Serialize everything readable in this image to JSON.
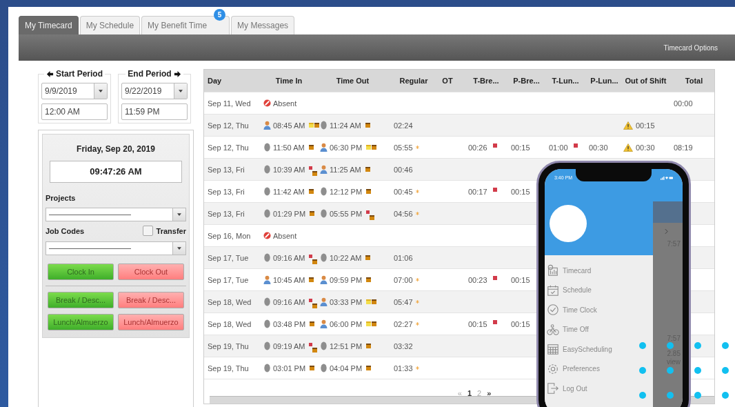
{
  "tabs": [
    {
      "label": "My Timecard",
      "selected": true
    },
    {
      "label": "My Schedule",
      "selected": false
    },
    {
      "label": "My Benefit Time",
      "selected": false,
      "badge": "5"
    },
    {
      "label": "My Messages",
      "selected": false
    }
  ],
  "toolbar": {
    "options": "Timecard Options"
  },
  "period": {
    "start": {
      "legend": "Start Period",
      "date": "9/9/2019",
      "time": "12:00 AM"
    },
    "end": {
      "legend": "End Period",
      "date": "9/22/2019",
      "time": "11:59 PM"
    }
  },
  "clock": {
    "date": "Friday, Sep 20, 2019",
    "time": "09:47:26 AM",
    "projects_label": "Projects",
    "job_codes_label": "Job Codes",
    "transfer": {
      "label": "Transfer",
      "checked": false
    },
    "buttons": [
      {
        "label": "Clock In",
        "kind": "in"
      },
      {
        "label": "Clock Out",
        "kind": "out"
      },
      {
        "label": "Break / Desc...",
        "kind": "in"
      },
      {
        "label": "Break / Desc...",
        "kind": "out"
      },
      {
        "label": "Lunch/Almuerzo",
        "kind": "in"
      },
      {
        "label": "Lunch/Almuerzo",
        "kind": "out"
      }
    ]
  },
  "table": {
    "columns": [
      "Day",
      "Time In",
      "Time Out",
      "Regular",
      "OT",
      "T-Bre...",
      "P-Bre...",
      "T-Lun...",
      "P-Lun...",
      "Out of Shift",
      "Total"
    ],
    "rows": [
      {
        "day": "Sep 11, Wed",
        "time_in": {
          "kind": "absent",
          "time": "Absent"
        },
        "total": "00:00"
      },
      {
        "day": "Sep 12, Thu",
        "time_in": {
          "kind": "person",
          "time": "08:45 AM",
          "markers": [
            {
              "kind": "note"
            },
            {
              "kind": "pay"
            }
          ]
        },
        "time_out": {
          "kind": "fingerprint",
          "time": "11:24 AM",
          "markers": [
            {
              "kind": "pay"
            }
          ]
        },
        "regular": {
          "value": "02:24",
          "starred": false
        },
        "out_of_shift": {
          "value": "00:15",
          "warning": true
        }
      },
      {
        "day": "Sep 12, Thu",
        "time_in": {
          "kind": "fingerprint",
          "time": "11:50 AM",
          "markers": [
            {
              "kind": "pay"
            }
          ]
        },
        "time_out": {
          "kind": "person",
          "time": "06:30 PM",
          "markers": [
            {
              "kind": "note"
            },
            {
              "kind": "pay"
            }
          ]
        },
        "regular": {
          "value": "05:55",
          "starred": true
        },
        "t_break": {
          "value": "00:26",
          "flag": true
        },
        "p_break": "00:15",
        "t_lunch": {
          "value": "01:00",
          "flag": true
        },
        "p_lunch": "00:30",
        "out_of_shift": {
          "value": "00:30",
          "warning": true
        },
        "total": "08:19"
      },
      {
        "day": "Sep 13, Fri",
        "time_in": {
          "kind": "fingerprint",
          "time": "10:39 AM",
          "markers": [
            {
              "kind": "alert"
            },
            {
              "kind": "pay"
            }
          ]
        },
        "time_out": {
          "kind": "person",
          "time": "11:25 AM",
          "markers": [
            {
              "kind": "pay"
            }
          ]
        },
        "regular": {
          "value": "00:46",
          "starred": false
        }
      },
      {
        "day": "Sep 13, Fri",
        "time_in": {
          "kind": "fingerprint",
          "time": "11:42 AM",
          "markers": [
            {
              "kind": "pay"
            }
          ]
        },
        "time_out": {
          "kind": "fingerprint",
          "time": "12:12 PM",
          "markers": [
            {
              "kind": "pay"
            }
          ]
        },
        "regular": {
          "value": "00:45",
          "starred": true
        },
        "t_break": {
          "value": "00:17",
          "flag": true
        },
        "p_break": "00:15"
      },
      {
        "day": "Sep 13, Fri",
        "time_in": {
          "kind": "fingerprint",
          "time": "01:29 PM",
          "markers": [
            {
              "kind": "pay"
            }
          ]
        },
        "time_out": {
          "kind": "fingerprint",
          "time": "05:55 PM",
          "markers": [
            {
              "kind": "alert"
            },
            {
              "kind": "pay"
            }
          ]
        },
        "regular": {
          "value": "04:56",
          "starred": true
        }
      },
      {
        "day": "Sep 16, Mon",
        "time_in": {
          "kind": "absent",
          "time": "Absent"
        }
      },
      {
        "day": "Sep 17, Tue",
        "time_in": {
          "kind": "fingerprint",
          "time": "09:16 AM",
          "markers": [
            {
              "kind": "alert"
            },
            {
              "kind": "pay"
            }
          ]
        },
        "time_out": {
          "kind": "fingerprint",
          "time": "10:22 AM",
          "markers": [
            {
              "kind": "pay"
            }
          ]
        },
        "regular": {
          "value": "01:06",
          "starred": false
        }
      },
      {
        "day": "Sep 17, Tue",
        "time_in": {
          "kind": "person",
          "time": "10:45 AM",
          "markers": [
            {
              "kind": "pay"
            }
          ]
        },
        "time_out": {
          "kind": "person",
          "time": "09:59 PM",
          "markers": [
            {
              "kind": "pay"
            }
          ]
        },
        "regular": {
          "value": "07:00",
          "starred": true
        },
        "t_break": {
          "value": "00:23",
          "flag": true
        },
        "p_break": "00:15"
      },
      {
        "day": "Sep 18, Wed",
        "time_in": {
          "kind": "fingerprint",
          "time": "09:16 AM",
          "markers": [
            {
              "kind": "alert"
            },
            {
              "kind": "pay"
            }
          ]
        },
        "time_out": {
          "kind": "person",
          "time": "03:33 PM",
          "markers": [
            {
              "kind": "note"
            },
            {
              "kind": "pay"
            }
          ]
        },
        "regular": {
          "value": "05:47",
          "starred": true
        }
      },
      {
        "day": "Sep 18, Wed",
        "time_in": {
          "kind": "fingerprint",
          "time": "03:48 PM",
          "markers": [
            {
              "kind": "pay"
            }
          ]
        },
        "time_out": {
          "kind": "person",
          "time": "06:00 PM",
          "markers": [
            {
              "kind": "note"
            },
            {
              "kind": "pay"
            }
          ]
        },
        "regular": {
          "value": "02:27",
          "starred": true
        },
        "t_break": {
          "value": "00:15",
          "flag": true
        },
        "p_break": "00:15"
      },
      {
        "day": "Sep 19, Thu",
        "time_in": {
          "kind": "fingerprint",
          "time": "09:19 AM",
          "markers": [
            {
              "kind": "alert"
            },
            {
              "kind": "pay"
            }
          ]
        },
        "time_out": {
          "kind": "fingerprint",
          "time": "12:51 PM",
          "markers": [
            {
              "kind": "pay"
            }
          ]
        },
        "regular": {
          "value": "03:32",
          "starred": false
        }
      },
      {
        "day": "Sep 19, Thu",
        "time_in": {
          "kind": "fingerprint",
          "time": "03:01 PM",
          "markers": [
            {
              "kind": "pay"
            }
          ]
        },
        "time_out": {
          "kind": "fingerprint",
          "time": "04:04 PM",
          "markers": [
            {
              "kind": "pay"
            }
          ]
        },
        "regular": {
          "value": "01:33",
          "starred": true
        }
      }
    ],
    "pagination": {
      "first": "«",
      "pages": [
        {
          "label": "1",
          "selected": true
        },
        {
          "label": "2",
          "selected": false
        }
      ],
      "next": "»"
    }
  },
  "phone": {
    "status_time": "3:40 PM",
    "menu": [
      {
        "label": "Timecard",
        "kind": "timecard"
      },
      {
        "label": "Schedule",
        "kind": "schedule"
      },
      {
        "label": "Time Clock",
        "kind": "clock"
      },
      {
        "label": "Time Off",
        "kind": "timeoff"
      },
      {
        "label": "EasyScheduling",
        "kind": "grid"
      },
      {
        "label": "Preferences",
        "kind": "gear"
      },
      {
        "label": "Log Out",
        "kind": "logout"
      }
    ],
    "background_texts": [
      "7:57",
      "7:57",
      "2.85",
      "view"
    ]
  }
}
